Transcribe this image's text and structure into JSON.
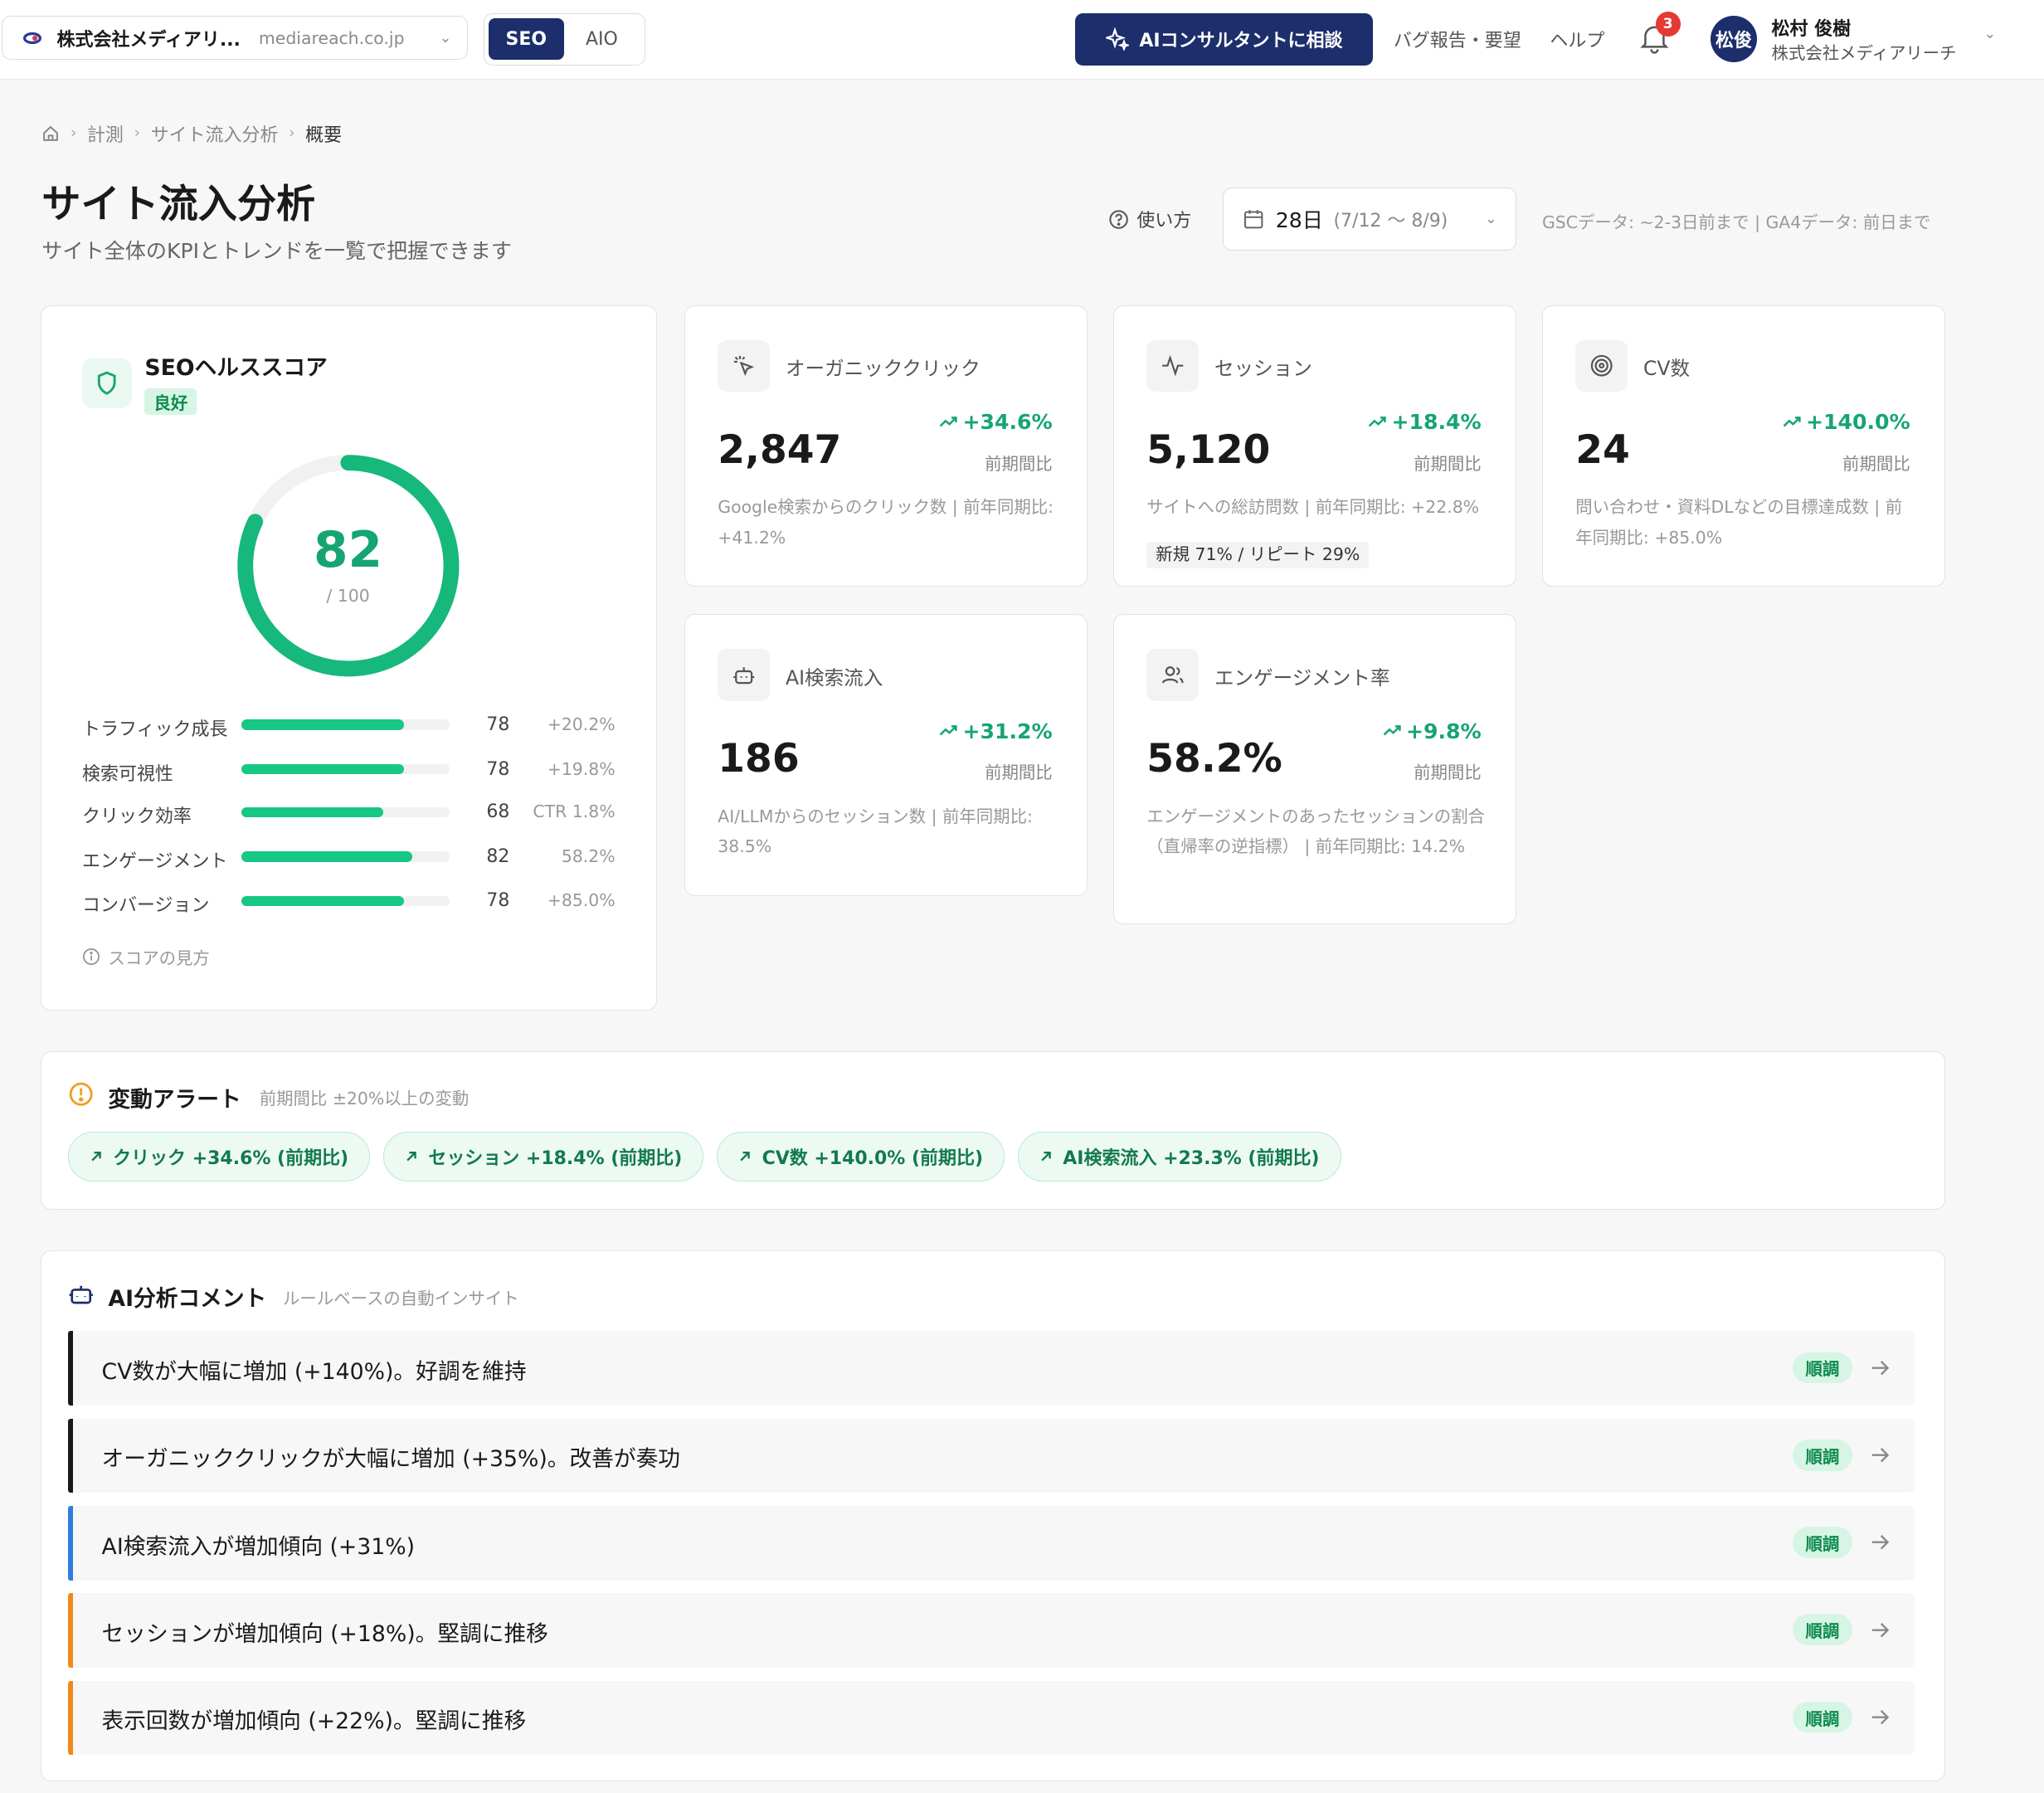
{
  "topbar": {
    "site_name": "株式会社メディアリ...",
    "site_domain": "mediareach.co.jp",
    "modes": [
      "SEO",
      "AIO"
    ],
    "active_mode": "SEO",
    "ai_consult_label": "AIコンサルタントに相談",
    "bug_report_label": "バグ報告・要望",
    "help_label": "ヘルプ",
    "notification_count": "3",
    "user_initials": "松俊",
    "user_name": "松村 俊樹",
    "user_company": "株式会社メディアリーチ"
  },
  "breadcrumb": [
    "計測",
    "サイト流入分析",
    "概要"
  ],
  "header": {
    "title": "サイト流入分析",
    "subtitle": "サイト全体のKPIとトレンドを一覧で把握できます",
    "howto_label": "使い方",
    "date_days": "28日",
    "date_range": "(7/12 〜 8/9)",
    "data_note": "GSCデータ: ~2-3日前まで | GA4データ: 前日まで"
  },
  "health": {
    "title": "SEOヘルススコア",
    "badge": "良好",
    "score": "82",
    "score_max": "/ 100",
    "score_fraction": 0.82,
    "metrics": [
      {
        "label": "トラフィック成長",
        "value": "78",
        "change": "+20.2%",
        "level": 0.78
      },
      {
        "label": "検索可視性",
        "value": "78",
        "change": "+19.8%",
        "level": 0.78
      },
      {
        "label": "クリック効率",
        "value": "68",
        "change": "CTR 1.8%",
        "level": 0.68
      },
      {
        "label": "エンゲージメント",
        "value": "82",
        "change": "58.2%",
        "level": 0.82
      },
      {
        "label": "コンバージョン",
        "value": "78",
        "change": "+85.0%",
        "level": 0.78
      }
    ],
    "help_label": "スコアの見方"
  },
  "kpis": [
    {
      "title": "オーガニッククリック",
      "value": "2,847",
      "change": "+34.6%",
      "period": "前期間比",
      "desc": "Google検索からのクリック数 | 前年同期比: +41.2%",
      "icon": "cursor-click-icon"
    },
    {
      "title": "セッション",
      "value": "5,120",
      "change": "+18.4%",
      "period": "前期間比",
      "desc": "サイトへの総訪問数 | 前年同期比: +22.8%",
      "extra": "新規 71% / リピート 29%",
      "icon": "activity-icon"
    },
    {
      "title": "CV数",
      "value": "24",
      "change": "+140.0%",
      "period": "前期間比",
      "desc": "問い合わせ・資料DLなどの目標達成数 | 前年同期比: +85.0%",
      "icon": "target-icon"
    },
    {
      "title": "AI検索流入",
      "value": "186",
      "change": "+31.2%",
      "period": "前期間比",
      "desc": "AI/LLMからのセッション数 | 前年同期比: 38.5%",
      "icon": "bot-icon"
    },
    {
      "title": "エンゲージメント率",
      "value": "58.2%",
      "change": "+9.8%",
      "period": "前期間比",
      "desc": "エンゲージメントのあったセッションの割合（直帰率の逆指標） | 前年同期比: 14.2%",
      "icon": "users-icon"
    }
  ],
  "alerts": {
    "title": "変動アラート",
    "subtitle": "前期間比 ±20%以上の変動",
    "chips": [
      "クリック +34.6% (前期比)",
      "セッション +18.4% (前期比)",
      "CV数 +140.0% (前期比)",
      "AI検索流入 +23.3% (前期比)"
    ]
  },
  "ai_comments": {
    "title": "AI分析コメント",
    "subtitle": "ルールベースの自動インサイト",
    "items": [
      {
        "text": "CV数が大幅に増加 (+140%)。好調を維持",
        "tag": "順調",
        "accent": "#1a1a1a"
      },
      {
        "text": "オーガニッククリックが大幅に増加 (+35%)。改善が奏功",
        "tag": "順調",
        "accent": "#1a1a1a"
      },
      {
        "text": "AI検索流入が増加傾向 (+31%)",
        "tag": "順調",
        "accent": "#2f7de1"
      },
      {
        "text": "セッションが増加傾向 (+18%)。堅調に推移",
        "tag": "順調",
        "accent": "#f08a1c"
      },
      {
        "text": "表示回数が増加傾向 (+22%)。堅調に推移",
        "tag": "順調",
        "accent": "#f08a1c"
      }
    ]
  },
  "colors": {
    "brand": "#1c2e6b",
    "positive": "#16a571",
    "bar": "#17c784"
  }
}
